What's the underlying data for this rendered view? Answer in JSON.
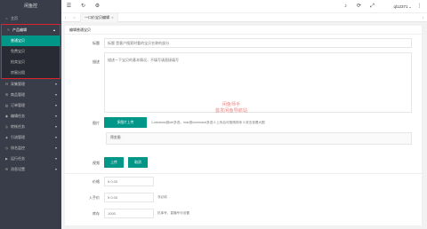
{
  "app": {
    "logo": "闲鱼控"
  },
  "sidebar": {
    "items_before": [
      {
        "label": "主页",
        "icon": "home-icon",
        "glyph": "⌂"
      }
    ],
    "group": {
      "label": "产品编辑",
      "icon": "edit-icon",
      "glyph": "✎",
      "children": [
        {
          "label": "普通宝贝",
          "active": true
        },
        {
          "label": "免费宝贝",
          "active": false
        },
        {
          "label": "拍卖宝贝",
          "active": false
        },
        {
          "label": "房屋出租",
          "active": false
        }
      ]
    },
    "items_after": [
      {
        "label": "采集管理",
        "icon": "collect-icon",
        "glyph": "☷"
      },
      {
        "label": "商品管理",
        "icon": "goods-icon",
        "glyph": "☰"
      },
      {
        "label": "订单管理",
        "icon": "order-icon",
        "glyph": "▤"
      },
      {
        "label": "编辑任务",
        "icon": "task-icon",
        "glyph": "◉"
      },
      {
        "label": "转帐任务",
        "icon": "transfer-icon",
        "glyph": "◎"
      },
      {
        "label": "引流管理",
        "icon": "traffic-icon",
        "glyph": "◈"
      },
      {
        "label": "排名监控",
        "icon": "rank-icon",
        "glyph": "◷"
      },
      {
        "label": "运行任务",
        "icon": "run-icon",
        "glyph": "▶"
      },
      {
        "label": "消息设置",
        "icon": "message-icon",
        "glyph": "✉"
      }
    ]
  },
  "topbar": {
    "user": "ql12371"
  },
  "tabs": {
    "active": "一口价宝贝编辑",
    "close": "✕"
  },
  "card": {
    "header": "编辑普通宝贝"
  },
  "form": {
    "title_label": "标题",
    "title_placeholder": "标题 是客户搜索时看的宝贝名称的部分",
    "desc_label": "描述",
    "desc_placeholder": "描述一下宝贝的基本情况，不填写请直接填写",
    "image_label": "图片",
    "image_button": "多图片上传",
    "image_hint": "1.windows按ctrl多选，mac按command多选 2.上传后可拖拽排序 3.双击查看大图",
    "preview_label": "预览图:",
    "video_label": "视频",
    "video_upload": "上传",
    "video_cancel": "取消",
    "price_label": "价格",
    "price_placeholder": "¥ 0.00",
    "cost_label": "入手价",
    "cost_placeholder": "¥ 0.00",
    "cost_hint": "非必填",
    "stock_label": "库存",
    "stock_placeholder": "1000",
    "stock_hint": "抗库号，直播专可设置"
  },
  "watermark": {
    "line1": "闲鱼师手",
    "line2": "首发闲鱼导航站"
  }
}
